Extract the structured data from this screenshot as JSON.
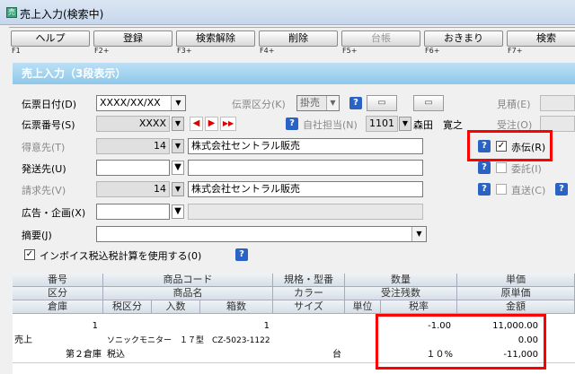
{
  "window": {
    "title": "売上入力(検索中)",
    "icon": "app-icon"
  },
  "fkeys": [
    {
      "label": "ヘルプ",
      "key": "F1",
      "enabled": true
    },
    {
      "label": "登録",
      "key": "F2+",
      "enabled": true
    },
    {
      "label": "検索解除",
      "key": "F3+",
      "enabled": true
    },
    {
      "label": "削除",
      "key": "F4+",
      "enabled": true
    },
    {
      "label": "台帳",
      "key": "F5+",
      "enabled": false
    },
    {
      "label": "おきまり",
      "key": "F6+",
      "enabled": true
    },
    {
      "label": "検索",
      "key": "F7+",
      "enabled": true
    }
  ],
  "section": {
    "title": "売上入力（3段表示）"
  },
  "form": {
    "denpyo_date": {
      "label": "伝票日付(D)",
      "value": "XXXX/XX/XX"
    },
    "denpyo_kubun": {
      "label": "伝票区分(K)",
      "value": "掛売"
    },
    "denpyo_no": {
      "label": "伝票番号(S)",
      "value": "XXXX"
    },
    "tantosha": {
      "label": "自社担当(N)",
      "code": "1101",
      "name": "森田　寛之"
    },
    "mitsumori": {
      "label": "見積(E)"
    },
    "juchu": {
      "label": "受注(O)"
    },
    "tokuisaki": {
      "label": "得意先(T)",
      "code": "14",
      "name": "株式会社セントラル販売"
    },
    "akaden": {
      "label": "赤伝(R)",
      "checked": true
    },
    "hassosaki": {
      "label": "発送先(U)"
    },
    "itaku": {
      "label": "委託(I)",
      "checked": false
    },
    "seikyusaki": {
      "label": "請求先(V)",
      "code": "14",
      "name": "株式会社セントラル販売"
    },
    "chokuso": {
      "label": "直送(C)",
      "checked": false
    },
    "kokoku": {
      "label": "広告・企画(X)"
    },
    "tekiyo": {
      "label": "摘要(J)"
    },
    "invoice": {
      "label": "インボイス税込税計算を使用する(0)",
      "checked": true
    }
  },
  "grid": {
    "header_rows": [
      [
        "番号",
        "商品コード",
        "規格・型番",
        "数量",
        "単価"
      ],
      [
        "区分",
        "商品名",
        "カラー",
        "受注残数",
        "原単価"
      ],
      [
        "倉庫",
        "税区分",
        "入数",
        "箱数",
        "サイズ",
        "単位",
        "税率",
        "金額"
      ]
    ],
    "row": {
      "line_no": "1",
      "qty_top": "1",
      "price_top": "-1.00",
      "unit_price": "11,000.00",
      "kubun": "売上",
      "product_name": "ソニックモニター　１７型　CZ-5023-1122",
      "cost_price": "0.00",
      "warehouse": "第２倉庫",
      "tax_kubun": "税込",
      "unit": "台",
      "tax_rate": "１０%",
      "amount": "-11,000"
    }
  },
  "colors": {
    "section_bar": "#8ec8ea",
    "highlight": "#ff0000",
    "help": "#2b63c4"
  }
}
